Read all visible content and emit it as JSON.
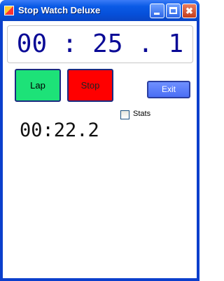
{
  "window": {
    "title": "Stop Watch Deluxe",
    "titlebar_color": "#0a5ae6"
  },
  "titlebar_buttons": {
    "minimize": "minimize-icon",
    "maximize": "maximize-icon",
    "close": "✖"
  },
  "display": {
    "main_time": "00 : 25 . 1",
    "lap_time": "00:22.2",
    "main_color": "#0a0a96"
  },
  "buttons": {
    "lap": "Lap",
    "stop": "Stop",
    "exit": "Exit",
    "lap_color": "#1de278",
    "stop_color": "#ff0000"
  },
  "stats": {
    "label": "Stats",
    "checked": false
  }
}
